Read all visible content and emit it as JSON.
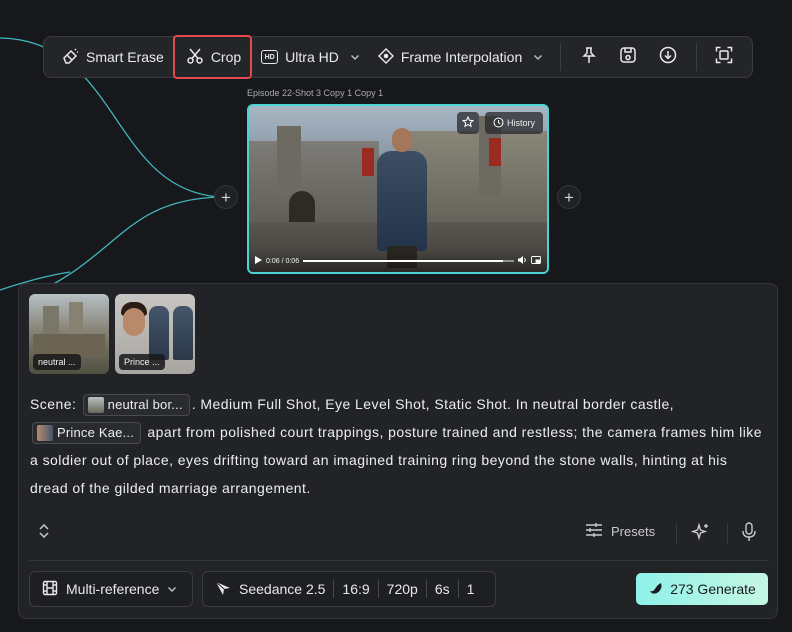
{
  "toolbar": {
    "smart_erase": "Smart Erase",
    "crop": "Crop",
    "ultra_hd": "Ultra HD",
    "frame_interpolation": "Frame Interpolation",
    "hd_badge": "HD"
  },
  "video": {
    "title": "Episode 22-Shot 3 Copy 1 Copy 1",
    "history_label": "History",
    "time": "0:06 / 0:06",
    "progress": 0.95
  },
  "references": [
    {
      "label": "neutral ..."
    },
    {
      "label": "Prince ..."
    }
  ],
  "prompt": {
    "scene_label": "Scene:",
    "chip1": "neutral bor...",
    "text1": ". Medium Full Shot, Eye Level Shot, Static Shot. In neutral border castle,",
    "chip2": "Prince Kae...",
    "text2": " apart from polished court trappings, posture trained and restless; the camera frames him like a soldier out of place, eyes drifting toward an imagined training ring beyond the stone walls, hinting at his dread of the gilded marriage arrangement."
  },
  "tools": {
    "presets": "Presets"
  },
  "bottom": {
    "mode": "Multi-reference",
    "model": "Seedance 2.5",
    "ratio": "16:9",
    "resolution": "720p",
    "duration": "6s",
    "count": "1",
    "generate": "273 Generate"
  },
  "colors": {
    "accent_cyan": "#4ad5d4",
    "crop_highlight": "#e5484d",
    "generate_from": "#8ff1e9",
    "generate_to": "#c6f7e3"
  }
}
